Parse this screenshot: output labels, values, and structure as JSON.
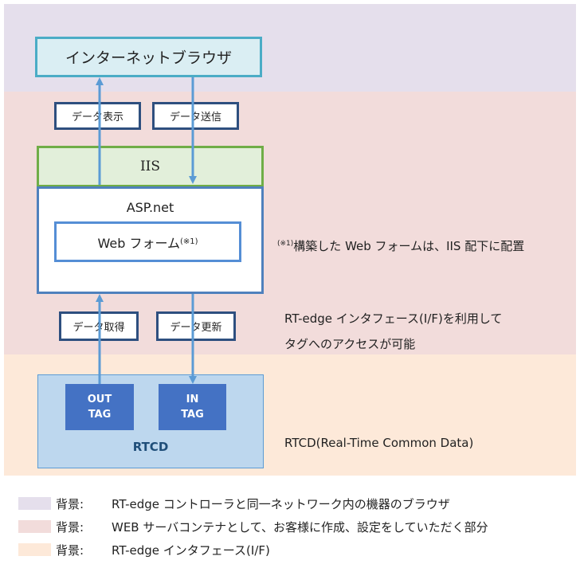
{
  "zones": {
    "browser_zone": {
      "color": "#e5dfec"
    },
    "web_zone": {
      "color": "#f2dcdb"
    },
    "interface_zone": {
      "color": "#fde9d9"
    }
  },
  "nodes": {
    "browser": "インターネットブラウザ",
    "iis": "IIS",
    "aspnet": "ASP.net",
    "webform": "Web フォーム",
    "webform_note_mark": "(※1)",
    "out_tag_line1": "OUT",
    "out_tag_line2": "TAG",
    "in_tag_line1": "IN",
    "in_tag_line2": "TAG",
    "rtcd": "RTCD"
  },
  "edges": {
    "display": "データ表示",
    "send": "データ送信",
    "acquire": "データ取得",
    "update": "データ更新"
  },
  "notes": {
    "footnote_mark": "(※1)",
    "footnote_text": "構築した Web フォームは、IIS 配下に配置",
    "interface_line1": "RT-edge インタフェース(I/F)を利用して",
    "interface_line2": "タグへのアクセスが可能",
    "rtcd_full": "RTCD(Real-Time Common Data)"
  },
  "legend": [
    {
      "key": "背景:",
      "text": "RT-edge コントローラと同一ネットワーク内の機器のブラウザ",
      "color": "#e5dfec"
    },
    {
      "key": "背景:",
      "text": "WEB  サーバコンテナとして、お客様に作成、設定をしていただく部分",
      "color": "#f2dcdb"
    },
    {
      "key": "背景:",
      "text": "RT-edge  インタフェース(I/F)",
      "color": "#fde9d9"
    }
  ],
  "colors": {
    "arrow": "#5b9bd5",
    "browser_border": "#4bacc6",
    "iis_border": "#70ad47",
    "asp_border": "#4f81bd",
    "tag_fill": "#4472c4",
    "rtcd_fill": "#bdd7ee"
  }
}
